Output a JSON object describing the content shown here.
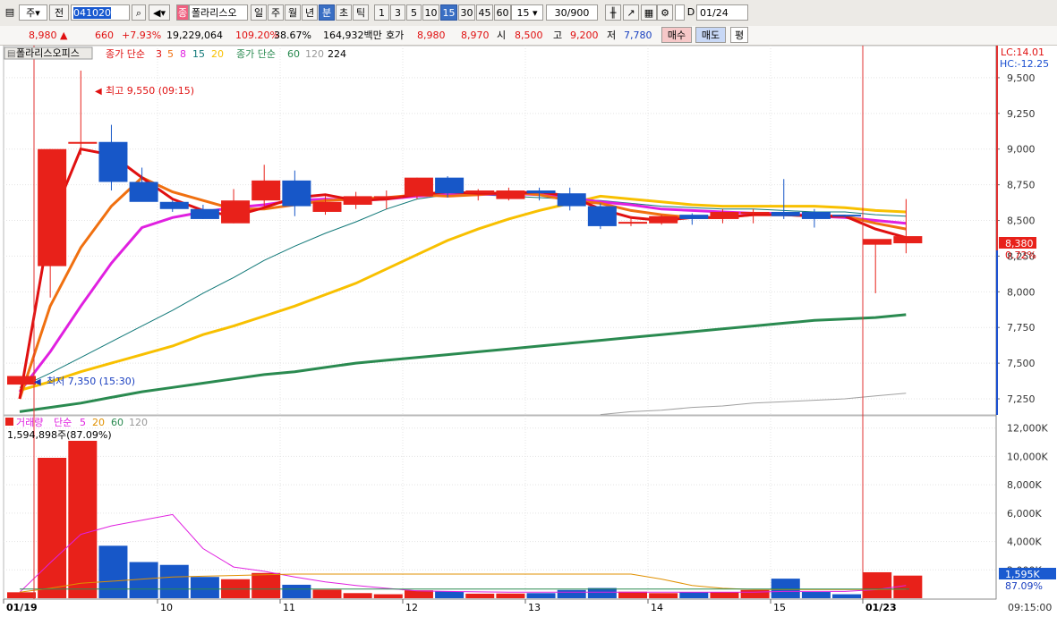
{
  "toolbar": {
    "market": "주",
    "prev_label": "전",
    "code": "041020",
    "stock_badge": "종",
    "stock_name": "폴라리스오",
    "periods": [
      "일",
      "주",
      "월",
      "년",
      "분",
      "초",
      "틱"
    ],
    "selected_period": "분",
    "intervals": [
      "1",
      "3",
      "5",
      "10",
      "15",
      "30",
      "45",
      "60"
    ],
    "selected_interval": "15",
    "interval_value": "15",
    "count": "30/900",
    "date_check": "D",
    "date": "01/24"
  },
  "quote": {
    "price": "8,980",
    "price_arrow": "▲",
    "change": "660",
    "change_pct": "+7.93%",
    "volume": "19,229,064",
    "volume_ratio": "109.20%",
    "turnover": "38.67%",
    "amount": "164,932백만",
    "hoga_label": "호가",
    "ask": "8,980",
    "bid": "8,970",
    "open_label": "시",
    "open": "8,500",
    "high_label": "고",
    "high": "9,200",
    "low_label": "저",
    "low": "7,780",
    "buy_button": "매수",
    "sell_button": "매도",
    "avg_button": "평"
  },
  "price_panel": {
    "name_tab": "폴라리스오피스",
    "ma_title": "종가 단순",
    "ma_short": [
      "3",
      "5",
      "8",
      "15",
      "20"
    ],
    "ma_long_title": "종가 단순",
    "ma_long": [
      "60",
      "120",
      "224"
    ],
    "lc_label": "LC:14.01",
    "hc_label": "HC:-12.25",
    "high_note": "최고 9,550 (09:15)",
    "low_note": "최저 7,350 (15:30)",
    "last_price_label": "8,380",
    "last_change_label": "0.72%"
  },
  "volume_panel": {
    "title": "거래량",
    "ma_title": "단순",
    "ma": [
      "5",
      "20",
      "60",
      "120"
    ],
    "current": "1,594,898주(87.09%)",
    "last_vol_label": "1,595K",
    "last_vol_pct": "87.09%"
  },
  "colors": {
    "up": "#e8211a",
    "down": "#1757c8",
    "ma3": "#e01010",
    "ma5": "#f07010",
    "ma8": "#e020e0",
    "ma15": "#107878",
    "ma20": "#f8c000",
    "ma60": "#2a8a50",
    "ma120": "#a0a0a0"
  },
  "chart_data": {
    "type": "candlestick",
    "x_tick_labels": [
      "01/19",
      "10",
      "11",
      "12",
      "13",
      "14",
      "15",
      "01/23"
    ],
    "time_axis_label": "09:15:00",
    "price_ticks": [
      "9,500",
      "9,250",
      "9,000",
      "8,750",
      "8,500",
      "8,250",
      "8,000",
      "7,750",
      "7,500",
      "7,250"
    ],
    "volume_ticks": [
      "12,000K",
      "10,000K",
      "8,000K",
      "6,000K",
      "4,000K",
      "2,000K"
    ],
    "price_range": [
      7150,
      9700
    ],
    "volume_range": [
      0,
      12800
    ],
    "candles": [
      {
        "o": 7350,
        "h": 7410,
        "l": 7350,
        "c": 7410
      },
      {
        "o": 8180,
        "h": 9000,
        "l": 7960,
        "c": 9000
      },
      {
        "o": 9050,
        "h": 9550,
        "l": 8960,
        "c": 9050
      },
      {
        "o": 9050,
        "h": 9170,
        "l": 8710,
        "c": 8770
      },
      {
        "o": 8770,
        "h": 8870,
        "l": 8640,
        "c": 8630
      },
      {
        "o": 8630,
        "h": 8640,
        "l": 8560,
        "c": 8580
      },
      {
        "o": 8580,
        "h": 8610,
        "l": 8510,
        "c": 8510
      },
      {
        "o": 8480,
        "h": 8720,
        "l": 8480,
        "c": 8640
      },
      {
        "o": 8640,
        "h": 8890,
        "l": 8600,
        "c": 8780
      },
      {
        "o": 8780,
        "h": 8850,
        "l": 8530,
        "c": 8600
      },
      {
        "o": 8560,
        "h": 8670,
        "l": 8540,
        "c": 8630
      },
      {
        "o": 8610,
        "h": 8700,
        "l": 8580,
        "c": 8670
      },
      {
        "o": 8660,
        "h": 8710,
        "l": 8580,
        "c": 8670
      },
      {
        "o": 8670,
        "h": 8800,
        "l": 8650,
        "c": 8800
      },
      {
        "o": 8800,
        "h": 8810,
        "l": 8660,
        "c": 8690
      },
      {
        "o": 8690,
        "h": 8720,
        "l": 8640,
        "c": 8710
      },
      {
        "o": 8650,
        "h": 8730,
        "l": 8640,
        "c": 8710
      },
      {
        "o": 8710,
        "h": 8730,
        "l": 8640,
        "c": 8690
      },
      {
        "o": 8690,
        "h": 8730,
        "l": 8570,
        "c": 8600
      },
      {
        "o": 8600,
        "h": 8620,
        "l": 8440,
        "c": 8460
      },
      {
        "o": 8480,
        "h": 8530,
        "l": 8460,
        "c": 8490
      },
      {
        "o": 8480,
        "h": 8540,
        "l": 8470,
        "c": 8530
      },
      {
        "o": 8540,
        "h": 8550,
        "l": 8470,
        "c": 8510
      },
      {
        "o": 8510,
        "h": 8580,
        "l": 8480,
        "c": 8560
      },
      {
        "o": 8550,
        "h": 8580,
        "l": 8480,
        "c": 8560
      },
      {
        "o": 8560,
        "h": 8790,
        "l": 8510,
        "c": 8530
      },
      {
        "o": 8560,
        "h": 8580,
        "l": 8450,
        "c": 8510
      },
      {
        "o": 8540,
        "h": 8540,
        "l": 8520,
        "c": 8530
      },
      {
        "o": 8330,
        "h": 8360,
        "l": 7990,
        "c": 8370
      },
      {
        "o": 8340,
        "h": 8650,
        "l": 8270,
        "c": 8390
      }
    ],
    "volumes": [
      420,
      9900,
      11100,
      3700,
      2550,
      2350,
      1500,
      1340,
      1780,
      950,
      600,
      360,
      280,
      560,
      470,
      320,
      330,
      360,
      580,
      720,
      460,
      360,
      440,
      420,
      580,
      1380,
      440,
      280,
      1830,
      1595
    ],
    "ma_lines": {
      "ma3": [
        7250,
        8480,
        9000,
        8960,
        8800,
        8650,
        8570,
        8530,
        8590,
        8660,
        8680,
        8640,
        8650,
        8680,
        8700,
        8690,
        8690,
        8700,
        8670,
        8580,
        8520,
        8500,
        8520,
        8520,
        8540,
        8540,
        8530,
        8530,
        8440,
        8380
      ],
      "ma5": [
        7250,
        7900,
        8310,
        8600,
        8800,
        8700,
        8640,
        8580,
        8580,
        8610,
        8640,
        8650,
        8660,
        8680,
        8670,
        8680,
        8700,
        8680,
        8640,
        8620,
        8570,
        8540,
        8520,
        8520,
        8540,
        8540,
        8530,
        8530,
        8480,
        8440
      ],
      "ma8": [
        7300,
        7580,
        7900,
        8200,
        8450,
        8520,
        8560,
        8590,
        8610,
        8640,
        8650,
        8640,
        8650,
        8670,
        8680,
        8680,
        8690,
        8680,
        8660,
        8630,
        8610,
        8580,
        8570,
        8560,
        8550,
        8550,
        8530,
        8520,
        8500,
        8480
      ],
      "ma15": [
        7330,
        7430,
        7540,
        7650,
        7760,
        7870,
        7990,
        8100,
        8220,
        8320,
        8410,
        8490,
        8580,
        8650,
        8680,
        8680,
        8670,
        8660,
        8650,
        8640,
        8620,
        8600,
        8590,
        8580,
        8580,
        8570,
        8560,
        8560,
        8540,
        8530
      ],
      "ma20": [
        7310,
        7370,
        7440,
        7500,
        7560,
        7620,
        7700,
        7760,
        7830,
        7900,
        7980,
        8060,
        8160,
        8260,
        8360,
        8440,
        8510,
        8570,
        8620,
        8670,
        8650,
        8630,
        8610,
        8600,
        8600,
        8600,
        8600,
        8590,
        8570,
        8560
      ],
      "ma60": [
        7160,
        7190,
        7220,
        7260,
        7300,
        7330,
        7360,
        7390,
        7420,
        7440,
        7470,
        7500,
        7520,
        7540,
        7560,
        7580,
        7600,
        7620,
        7640,
        7660,
        7680,
        7700,
        7720,
        7740,
        7760,
        7780,
        7800,
        7810,
        7820,
        7840
      ],
      "ma120": [
        null,
        null,
        null,
        null,
        null,
        null,
        null,
        null,
        null,
        null,
        null,
        null,
        null,
        null,
        null,
        null,
        null,
        null,
        null,
        7140,
        7160,
        7170,
        7190,
        7200,
        7220,
        7230,
        7240,
        7250,
        7270,
        7290
      ]
    },
    "volume_ma5": [
      420,
      2500,
      4500,
      5100,
      5500,
      5900,
      3500,
      2200,
      1900,
      1500,
      1150,
      900,
      700,
      520,
      480,
      450,
      420,
      420,
      420,
      420,
      420,
      420,
      420,
      420,
      420,
      480,
      480,
      480,
      600,
      900
    ],
    "volume_ma20": [
      420,
      700,
      1050,
      1200,
      1350,
      1500,
      1550,
      1600,
      1650,
      1700,
      1700,
      1700,
      1700,
      1700,
      1700,
      1700,
      1700,
      1700,
      1700,
      1700,
      1700,
      1350,
      900,
      700,
      620,
      620,
      620,
      620,
      620,
      640
    ]
  }
}
